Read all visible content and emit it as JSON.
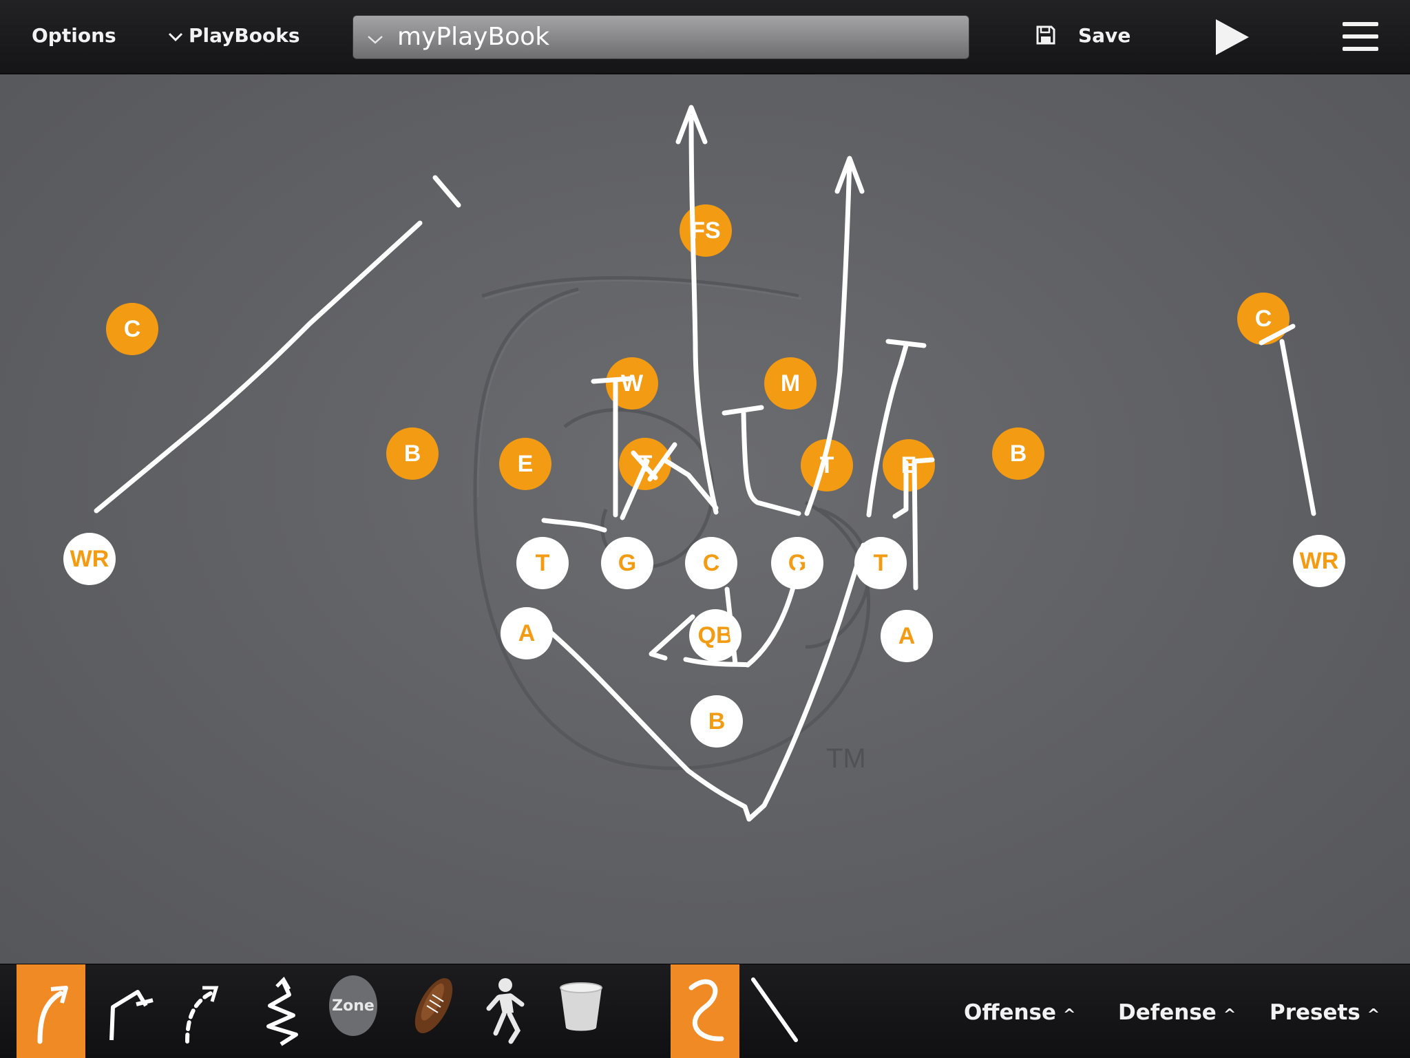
{
  "toolbar": {
    "options_label": "Options",
    "playbooks_label": "PlayBooks",
    "playbook_selected": "myPlayBook",
    "save_label": "Save",
    "icons": {
      "chevron": "chevron-down-icon",
      "save": "floppy-disk-icon",
      "play": "play-triangle-icon",
      "menu": "hamburger-menu-icon"
    }
  },
  "field": {
    "watermark_tm": "TM",
    "offense": [
      {
        "label": "WR"
      },
      {
        "label": "T"
      },
      {
        "label": "G"
      },
      {
        "label": "C"
      },
      {
        "label": "G"
      },
      {
        "label": "T"
      },
      {
        "label": "WR"
      },
      {
        "label": "A"
      },
      {
        "label": "QB"
      },
      {
        "label": "A"
      },
      {
        "label": "B"
      }
    ],
    "defense": [
      {
        "label": "FS"
      },
      {
        "label": "C"
      },
      {
        "label": "C"
      },
      {
        "label": "W"
      },
      {
        "label": "M"
      },
      {
        "label": "B"
      },
      {
        "label": "E"
      },
      {
        "label": "T"
      },
      {
        "label": "T"
      },
      {
        "label": "E"
      },
      {
        "label": "B"
      }
    ]
  },
  "bottom_toolbar": {
    "tools": [
      {
        "name": "curved-arrow-route-tool",
        "active": true
      },
      {
        "name": "block-route-tool",
        "active": false
      },
      {
        "name": "dashed-route-tool",
        "active": false
      },
      {
        "name": "zigzag-motion-tool",
        "active": false
      },
      {
        "name": "zone-tool",
        "label": "Zone",
        "active": false
      },
      {
        "name": "football-tool",
        "active": false
      },
      {
        "name": "player-tool",
        "active": false
      },
      {
        "name": "trash-tool",
        "active": false
      },
      {
        "name": "freehand-line-tool",
        "active": true
      },
      {
        "name": "straight-line-tool",
        "active": false
      }
    ],
    "menus": [
      {
        "label": "Offense"
      },
      {
        "label": "Defense"
      },
      {
        "label": "Presets"
      }
    ]
  },
  "colors": {
    "accent": "#f39b12",
    "active_tool": "#f08a24",
    "route_line": "#ffffff"
  }
}
